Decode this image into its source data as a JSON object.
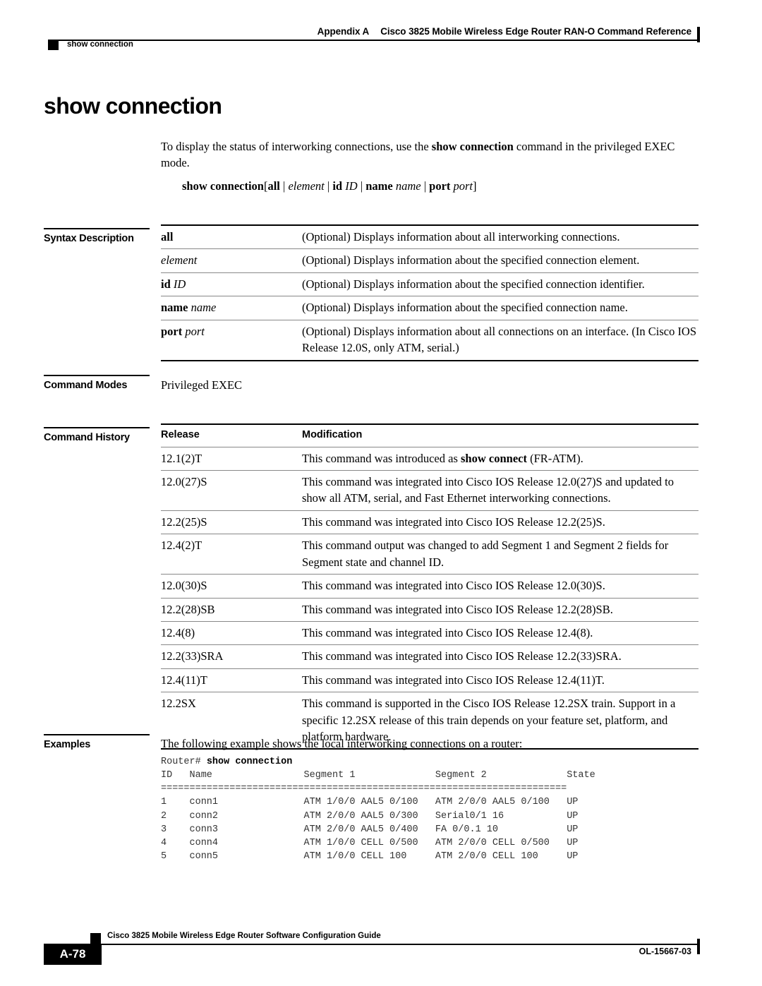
{
  "header": {
    "appendix": "Appendix A",
    "title": "Cisco 3825 Mobile Wireless Edge Router RAN-O Command Reference",
    "running_head": "show connection"
  },
  "page": {
    "command_title": "show connection",
    "intro": "To display the status of interworking connections, use the show connection command in the privileged EXEC mode.",
    "intro_pre": "To display the status of interworking connections, use the ",
    "intro_bold": "show connection",
    "intro_post": " command in the privileged EXEC mode.",
    "syntax": {
      "command": "show connection",
      "bracket_open": "[",
      "opt_all": "all",
      "sep": " | ",
      "opt_element": "element",
      "opt_id_kw": "id",
      "opt_id_arg": "ID",
      "opt_name_kw": "name",
      "opt_name_arg": "name",
      "opt_port_kw": "port",
      "opt_port_arg": "port",
      "bracket_close": "]"
    }
  },
  "syntax_description": {
    "label": "Syntax Description",
    "rows": [
      {
        "term": "all",
        "term_style": "bold",
        "desc": "(Optional) Displays information about all interworking connections."
      },
      {
        "term": "element",
        "term_style": "italic",
        "desc": "(Optional) Displays information about the specified connection element."
      },
      {
        "term_kw": "id",
        "term_arg": "ID",
        "term_style": "bold-italic",
        "desc": "(Optional) Displays information about the specified connection identifier."
      },
      {
        "term_kw": "name",
        "term_arg": "name",
        "term_style": "bold-italic",
        "desc": "(Optional) Displays information about the specified connection name."
      },
      {
        "term_kw": "port",
        "term_arg": "port",
        "term_style": "bold-italic",
        "desc": "(Optional) Displays information about all connections on an interface. (In Cisco IOS Release 12.0S, only ATM, serial.)"
      }
    ]
  },
  "command_modes": {
    "label": "Command Modes",
    "value": "Privileged EXEC"
  },
  "command_history": {
    "label": "Command History",
    "columns": [
      "Release",
      "Modification"
    ],
    "rows": [
      {
        "release": "12.1(2)T",
        "modification_pre": "This command was introduced as ",
        "modification_bold": "show connect",
        "modification_post": " (FR-ATM)."
      },
      {
        "release": "12.0(27)S",
        "modification": "This command was integrated into Cisco IOS Release 12.0(27)S and updated to show all ATM, serial, and Fast Ethernet interworking connections."
      },
      {
        "release": "12.2(25)S",
        "modification": "This command was integrated into Cisco IOS Release 12.2(25)S."
      },
      {
        "release": "12.4(2)T",
        "modification": "This command output was changed to add Segment 1 and Segment 2 fields for Segment state and channel ID."
      },
      {
        "release": "12.0(30)S",
        "modification": "This command was integrated into Cisco IOS Release 12.0(30)S."
      },
      {
        "release": "12.2(28)SB",
        "modification": "This command was integrated into Cisco IOS Release 12.2(28)SB."
      },
      {
        "release": "12.4(8)",
        "modification": "This command was integrated into Cisco IOS Release 12.4(8)."
      },
      {
        "release": "12.2(33)SRA",
        "modification": "This command was integrated into Cisco IOS Release 12.2(33)SRA."
      },
      {
        "release": "12.4(11)T",
        "modification": "This command was integrated into Cisco IOS Release 12.4(11)T."
      },
      {
        "release": "12.2SX",
        "modification": "This command is supported in the Cisco IOS Release 12.2SX train. Support in a specific 12.2SX release of this train depends on your feature set, platform, and platform hardware."
      }
    ]
  },
  "examples": {
    "label": "Examples",
    "intro": "The following example shows the local interworking connections on a router:",
    "prompt": "Router# ",
    "command": "show connection",
    "output": "ID   Name                ATM 1/0/0 AAL5 0/100   ATM 2/0/0 AAL5 0/100   UP",
    "output_lines": [
      "ID   Name                Segment 1              Segment 2              State",
      "=================================================================-----",
      "1    conn1               ATM 1/0/0 AAL5 0/100   ATM 2/0/0 AAL5 0/100   UP",
      "2    conn2               ATM 2/0/0 AAL5 0/300   Serial0/1 16           UP",
      "3    conn3               ATM 2/0/0 AAL5 0/400   FA 0/0.1 10            UP",
      "4    conn4               ATM 1/0/0 CELL 0/500   ATM 2/0/0 CELL 0/500   UP",
      "5    conn5               ATM 1/0/0 CELL 100     ATM 2/0/0 CELL 100     UP"
    ],
    "table_header": "ID   Name                Segment 1              Segment 2              State",
    "table_divider": "=======================================================================",
    "table_rows": [
      "1    conn1               ATM 1/0/0 AAL5 0/100   ATM 2/0/0 AAL5 0/100   UP",
      "2    conn2               ATM 2/0/0 AAL5 0/300   Serial0/1 16           UP",
      "3    conn3               ATM 2/0/0 AAL5 0/400   FA 0/0.1 10            UP",
      "4    conn4               ATM 1/0/0 CELL 0/500   ATM 2/0/0 CELL 0/500   UP",
      "5    conn5               ATM 1/0/0 CELL 100     ATM 2/0/0 CELL 100     UP"
    ]
  },
  "footer": {
    "guide_title": "Cisco 3825 Mobile Wireless Edge Router Software Configuration Guide",
    "page_number": "A-78",
    "doc_id": "OL-15667-03"
  }
}
